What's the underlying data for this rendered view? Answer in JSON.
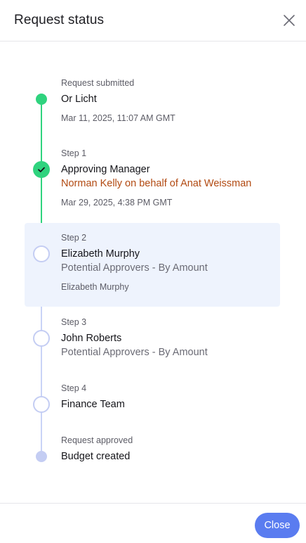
{
  "dialog": {
    "title": "Request status",
    "close_button_label": "Close"
  },
  "timeline": {
    "submitted": {
      "caption": "Request submitted",
      "name": "Or Licht",
      "date": "Mar 11, 2025, 11:07 AM GMT"
    },
    "steps": [
      {
        "caption": "Step 1",
        "name": "Approving Manager",
        "subtitle": "Norman Kelly on behalf of Anat Weissman",
        "date": "Mar 29, 2025, 4:38 PM GMT",
        "status": "completed"
      },
      {
        "caption": "Step 2",
        "name": "Elizabeth Murphy",
        "subtitle": "Potential Approvers - By Amount",
        "detail": "Elizabeth Murphy",
        "status": "current"
      },
      {
        "caption": "Step 3",
        "name": "John Roberts",
        "subtitle": "Potential Approvers - By Amount",
        "status": "pending"
      },
      {
        "caption": "Step 4",
        "name": "Finance Team",
        "status": "pending"
      }
    ],
    "approved": {
      "caption": "Request approved",
      "name": "Budget created"
    }
  },
  "colors": {
    "done": "#2fd37e",
    "pending": "#c4cdf3",
    "highlight": "#eef3fd",
    "accent": "#5a7cf0",
    "on_behalf": "#b24a12"
  },
  "icons": {
    "close": "close-icon",
    "check": "check-icon"
  }
}
